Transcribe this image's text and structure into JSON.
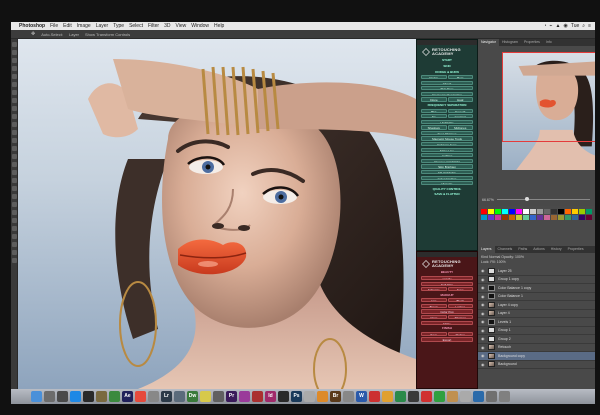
{
  "menubar": {
    "items": [
      "Photoshop",
      "File",
      "Edit",
      "Image",
      "Layer",
      "Type",
      "Select",
      "Filter",
      "3D",
      "View",
      "Window",
      "Help"
    ],
    "status": [
      "◔",
      "⌁",
      "▲",
      "◉",
      "Tue",
      "⌕",
      "≡"
    ]
  },
  "optbar": {
    "items": [
      "Auto-Select:",
      "Layer",
      "Show Transform Controls"
    ]
  },
  "actions_panel": {
    "header_label": "RETOUCH ACTIONS",
    "brand_lines": [
      "RETOUCHING",
      "ACADEMY"
    ],
    "buttons": [
      "START",
      "SKIN",
      "DODGE & BURN",
      "Dodge",
      "Burn",
      "Check",
      "Skin Tone",
      "Frequency Separation",
      "Clone",
      "Heal",
      "FREQUENCY SEPARATION",
      "Blur",
      "Smooth",
      "Fix",
      "Contrast",
      "Highlights",
      "Shadows",
      "Midtones",
      "Eyes Sharpen",
      "Magnetic Mouse Tools",
      "Enhance Eyes",
      "Make Lips",
      "Lighting",
      "Remove Catchlight",
      "Skin Brighten",
      "Fill Highlights",
      "Color Grading",
      "Vignette",
      "QUALITY CONTROL",
      "SAVE & FLATTEN"
    ]
  },
  "retouch_panel": {
    "brand_lines": [
      "RETOUCHING",
      "ACADEMY"
    ],
    "buttons": [
      "BEAUTY",
      "Liquify",
      "Soft Skin",
      "Enhance",
      "Eyes",
      "MAKEUP",
      "Lips",
      "Blush",
      "Brows",
      "Lashes",
      "Color Pop",
      "Glow",
      "Sharpen",
      "Matte",
      "FINISH",
      "Save",
      "Flatten",
      "Export"
    ]
  },
  "right_panel": {
    "nav_tabs": [
      "Navigator",
      "Histogram",
      "Properties",
      "Info"
    ],
    "zoom": "66.67%",
    "swatch_colors": [
      "#ff0000",
      "#ffff00",
      "#00ff00",
      "#00ffff",
      "#0000ff",
      "#ff00ff",
      "#ffffff",
      "#cccccc",
      "#999999",
      "#666666",
      "#333333",
      "#000000",
      "#ff6600",
      "#ffcc00",
      "#99cc00",
      "#009966",
      "#0099cc",
      "#6633cc",
      "#cc3399",
      "#993300",
      "#cc6600",
      "#cccc33",
      "#66cc99",
      "#3366cc",
      "#663399",
      "#cc6699",
      "#996633",
      "#999933",
      "#339966",
      "#336699",
      "#330066",
      "#660033"
    ],
    "layer_tabs": [
      "Layers",
      "Channels",
      "Paths",
      "Actions",
      "History",
      "Properties"
    ],
    "layer_opts": [
      "Kind  Normal   Opacity: 100%",
      "Lock:   Fill: 100%"
    ],
    "layers": [
      {
        "name": "Layer 25",
        "thumb": "white"
      },
      {
        "name": "Group 1 copy",
        "thumb": "white"
      },
      {
        "name": "Color Balance 1 copy",
        "thumb": "mask"
      },
      {
        "name": "Color Balance 1",
        "thumb": "mask"
      },
      {
        "name": "Layer 4 copy",
        "thumb": "img"
      },
      {
        "name": "Layer 4",
        "thumb": "img"
      },
      {
        "name": "Levels 1",
        "thumb": "mask"
      },
      {
        "name": "Group 1",
        "thumb": "white"
      },
      {
        "name": "Group 2",
        "thumb": "white"
      },
      {
        "name": "Retouch",
        "thumb": "img"
      },
      {
        "name": "Background copy",
        "thumb": "img"
      },
      {
        "name": "Background",
        "thumb": "img"
      }
    ],
    "selected_layer": 10
  },
  "dock": {
    "apps": [
      {
        "label": "",
        "color": "#4a90d9"
      },
      {
        "label": "",
        "color": "#6c6c6c"
      },
      {
        "label": "",
        "color": "#4a4a4a"
      },
      {
        "label": "",
        "color": "#1e88e5"
      },
      {
        "label": "",
        "color": "#2a2a2a"
      },
      {
        "label": "",
        "color": "#7a6a40"
      },
      {
        "label": "",
        "color": "#3b8a3e"
      },
      {
        "label": "Ae",
        "color": "#1f1f5a"
      },
      {
        "label": "",
        "color": "#e54a3c"
      },
      {
        "label": "",
        "color": "#888888"
      },
      {
        "label": "Lr",
        "color": "#2c3a48"
      },
      {
        "label": "",
        "color": "#5b6b7b"
      },
      {
        "label": "Dw",
        "color": "#3a7a3a"
      },
      {
        "label": "",
        "color": "#d7c94a"
      },
      {
        "label": "",
        "color": "#606060"
      },
      {
        "label": "Pr",
        "color": "#3a1a5a"
      },
      {
        "label": "",
        "color": "#9a3a9a"
      },
      {
        "label": "",
        "color": "#aa3030"
      },
      {
        "label": "Id",
        "color": "#a02a6a"
      },
      {
        "label": "",
        "color": "#2a2a2a"
      },
      {
        "label": "Ps",
        "color": "#1a3a5a"
      },
      {
        "label": "",
        "color": "#aaaaaa"
      },
      {
        "label": "",
        "color": "#dd8a2a"
      },
      {
        "label": "Br",
        "color": "#5a3a1a"
      },
      {
        "label": "",
        "color": "#888888"
      },
      {
        "label": "W",
        "color": "#2a5aaa"
      },
      {
        "label": "",
        "color": "#cc3030"
      },
      {
        "label": "",
        "color": "#e0a030"
      },
      {
        "label": "",
        "color": "#2a8a4a"
      },
      {
        "label": "",
        "color": "#3a3a3a"
      },
      {
        "label": "",
        "color": "#d03030"
      },
      {
        "label": "",
        "color": "#30a040"
      },
      {
        "label": "",
        "color": "#c09050"
      },
      {
        "label": "",
        "color": "#aaaaaa"
      },
      {
        "label": "",
        "color": "#2a6aaa"
      },
      {
        "label": "",
        "color": "#707070"
      },
      {
        "label": "",
        "color": "#808080"
      }
    ]
  }
}
